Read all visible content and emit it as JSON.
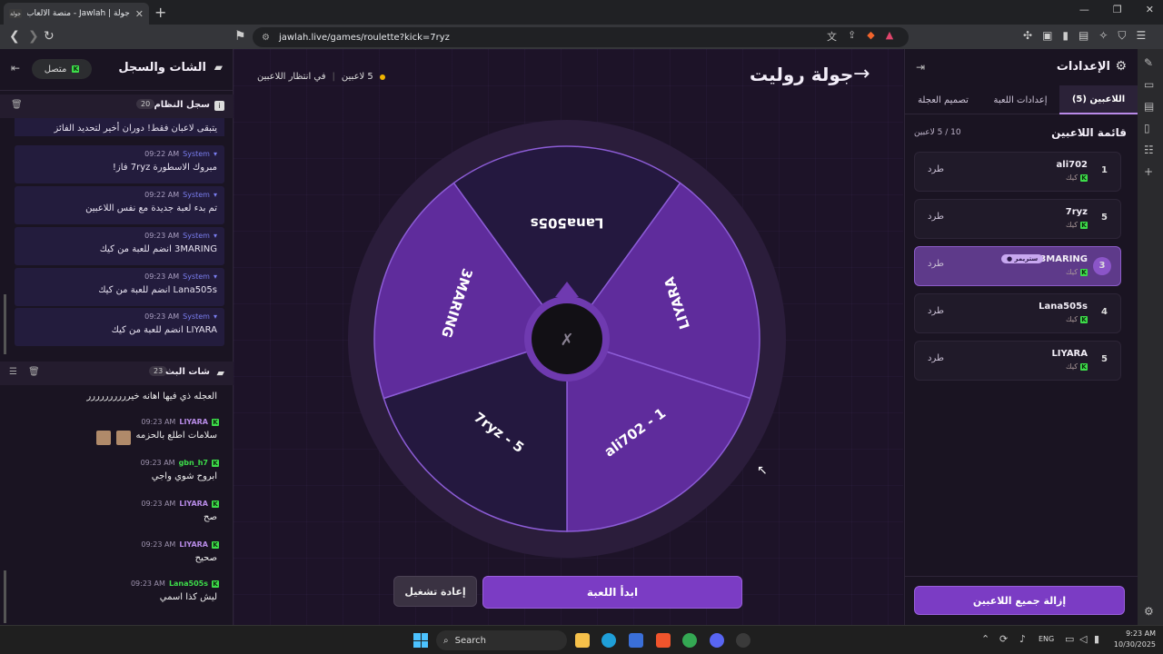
{
  "browser": {
    "tab_title": "جولة | Jawlah - منصة الألعاب التفا",
    "tab_favicon": "جولة",
    "url": "jawlah.live/games/roulette?kick=7ryz"
  },
  "header": {
    "title": "جولة روليت",
    "players_count": "5 لاعبين",
    "status": "في انتظار اللاعبين"
  },
  "wheel": {
    "segments": [
      {
        "label": "Lana505s"
      },
      {
        "label": "LIYARA"
      },
      {
        "label": "ali702 - 1"
      },
      {
        "label": "7ryz - 5"
      },
      {
        "label": "3MARING"
      }
    ],
    "colors": [
      "#24183f",
      "#5f2c9c",
      "#5f2c9c",
      "#24183f",
      "#5f2c9c"
    ]
  },
  "buttons": {
    "start": "ابدأ اللعبة",
    "restart": "إعادة تشغيل",
    "remove_all": "إزالة جميع اللاعبين"
  },
  "chat": {
    "title": "الشات والسجل",
    "connected": "متصل",
    "system_log": {
      "title": "سجل النظام",
      "count": "20",
      "partial_top": "يتبقى لاعبان فقط! دوران أخير لتحديد الفائز",
      "messages": [
        {
          "who": "System",
          "time": "09:22 AM",
          "text": "مبروك الاسطورة 7ryz فاز!"
        },
        {
          "who": "System",
          "time": "09:22 AM",
          "text": "تم بدء لعبة جديدة مع نفس اللاعبين"
        },
        {
          "who": "System",
          "time": "09:23 AM",
          "text": "3MARING انضم للعبة من كيك"
        },
        {
          "who": "System",
          "time": "09:23 AM",
          "text": "Lana505s انضم للعبة من كيك"
        },
        {
          "who": "System",
          "time": "09:23 AM",
          "text": "LIYARA انضم للعبة من كيك"
        }
      ]
    },
    "stream_chat": {
      "title": "شات البث",
      "count": "23",
      "partial_top": "العجله ذي فيها اهانه خيرررررررررر",
      "messages": [
        {
          "who": "LIYARA",
          "time": "09:23 AM",
          "text": "سلامات اطلع بالحزمه"
        },
        {
          "who": "gbn_h7",
          "time": "09:23 AM",
          "text": "ابروح شوي واجي"
        },
        {
          "who": "LIYARA",
          "time": "09:23 AM",
          "text": "صح"
        },
        {
          "who": "LIYARA",
          "time": "09:23 AM",
          "text": "صحيح"
        },
        {
          "who": "Lana505s",
          "time": "09:23 AM",
          "text": "ليش كذا اسمي"
        }
      ]
    }
  },
  "settings": {
    "title": "الإعدادات",
    "tabs": [
      "اللاعبين (5)",
      "إعدادات اللعبة",
      "تصميم العجلة"
    ],
    "list_title": "قائمة اللاعبين",
    "list_count": "10 / 5 لاعبين",
    "kick_word": "طرد",
    "platform": "كيك",
    "streamer_badge": "ستريمر",
    "players": [
      {
        "num": "1",
        "name": "ali702"
      },
      {
        "num": "5",
        "name": "7ryz"
      },
      {
        "num": "3",
        "name": "3MARING",
        "streamer": true
      },
      {
        "num": "4",
        "name": "Lana505s"
      },
      {
        "num": "5",
        "name": "LIYARA"
      }
    ]
  },
  "taskbar": {
    "search": "Search",
    "lang": "ENG",
    "time": "9:23 AM",
    "date": "10/30/2025"
  }
}
